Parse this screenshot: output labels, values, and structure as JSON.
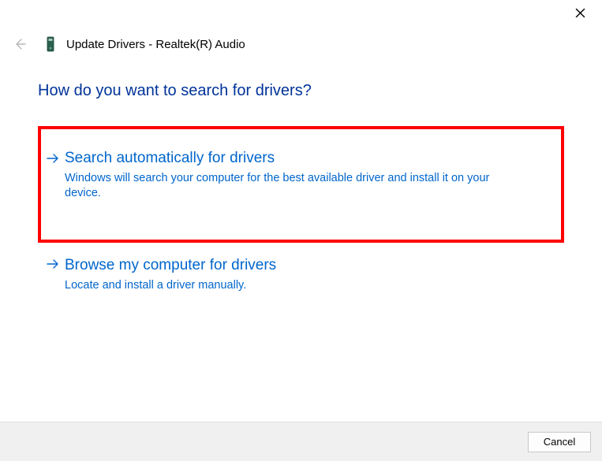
{
  "window": {
    "title": "Update Drivers - Realtek(R) Audio"
  },
  "heading": "How do you want to search for drivers?",
  "options": {
    "auto": {
      "title": "Search automatically for drivers",
      "desc": "Windows will search your computer for the best available driver and install it on your device."
    },
    "browse": {
      "title": "Browse my computer for drivers",
      "desc": "Locate and install a driver manually."
    }
  },
  "buttons": {
    "cancel": "Cancel"
  }
}
